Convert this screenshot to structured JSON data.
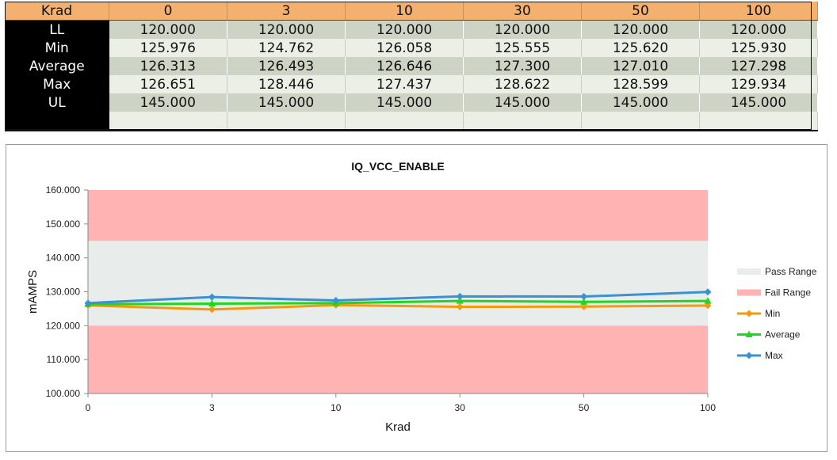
{
  "table": {
    "corner": "Krad",
    "columns": [
      "0",
      "3",
      "10",
      "30",
      "50",
      "100"
    ],
    "rows": [
      {
        "label": "LL",
        "values": [
          "120.000",
          "120.000",
          "120.000",
          "120.000",
          "120.000",
          "120.000"
        ]
      },
      {
        "label": "Min",
        "values": [
          "125.976",
          "124.762",
          "126.058",
          "125.555",
          "125.620",
          "125.930"
        ]
      },
      {
        "label": "Average",
        "values": [
          "126.313",
          "126.493",
          "126.646",
          "127.300",
          "127.010",
          "127.298"
        ]
      },
      {
        "label": "Max",
        "values": [
          "126.651",
          "128.446",
          "127.437",
          "128.622",
          "128.599",
          "129.934"
        ]
      },
      {
        "label": "UL",
        "values": [
          "145.000",
          "145.000",
          "145.000",
          "145.000",
          "145.000",
          "145.000"
        ]
      }
    ]
  },
  "chart_data": {
    "type": "line",
    "title": "IQ_VCC_ENABLE",
    "xlabel": "Krad",
    "ylabel": "mAMPS",
    "categories": [
      "0",
      "3",
      "10",
      "30",
      "50",
      "100"
    ],
    "ylim": [
      100,
      160
    ],
    "yticks": [
      "100.000",
      "110.000",
      "120.000",
      "130.000",
      "140.000",
      "150.000",
      "160.000"
    ],
    "bands": [
      {
        "name": "Pass Range",
        "from": 120,
        "to": 145,
        "color": "#e8ecea"
      },
      {
        "name": "Fail Range",
        "from": 100,
        "to": 120,
        "color": "#ffb3b3"
      },
      {
        "name": "Fail Range",
        "from": 145,
        "to": 160,
        "color": "#ffb3b3"
      }
    ],
    "series": [
      {
        "name": "Min",
        "values": [
          125.976,
          124.762,
          126.058,
          125.555,
          125.62,
          125.93
        ],
        "color": "#f59a0c",
        "marker": "diamond"
      },
      {
        "name": "Average",
        "values": [
          126.313,
          126.493,
          126.646,
          127.3,
          127.01,
          127.298
        ],
        "color": "#1ed71e",
        "marker": "triangle"
      },
      {
        "name": "Max",
        "values": [
          126.651,
          128.446,
          127.437,
          128.622,
          128.599,
          129.934
        ],
        "color": "#3a92cf",
        "marker": "diamond"
      }
    ],
    "legend": [
      {
        "name": "Pass Range",
        "kind": "band",
        "color": "#e8ecea"
      },
      {
        "name": "Fail Range",
        "kind": "band",
        "color": "#ffb3b3"
      },
      {
        "name": "Min",
        "kind": "line",
        "color": "#f59a0c",
        "marker": "diamond"
      },
      {
        "name": "Average",
        "kind": "line",
        "color": "#1ed71e",
        "marker": "triangle"
      },
      {
        "name": "Max",
        "kind": "line",
        "color": "#3a92cf",
        "marker": "diamond"
      }
    ],
    "legend_position": "right",
    "grid": false
  }
}
